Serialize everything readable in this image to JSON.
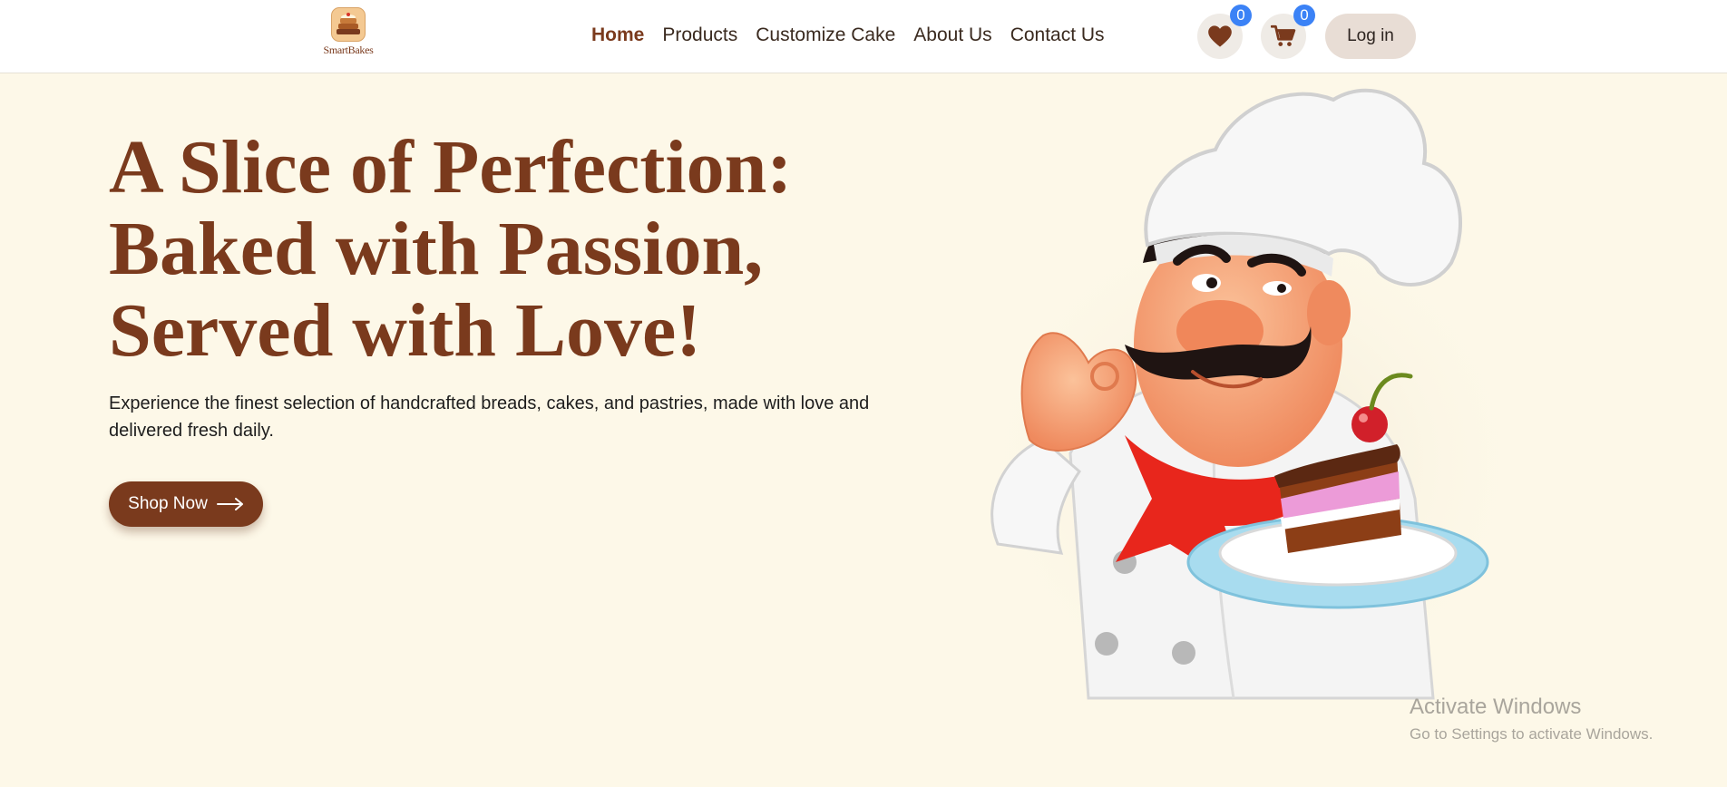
{
  "header": {
    "logo_text": "SmartBakes",
    "nav": [
      {
        "label": "Home",
        "active": true
      },
      {
        "label": "Products",
        "active": false
      },
      {
        "label": "Customize Cake",
        "active": false
      },
      {
        "label": "About Us",
        "active": false
      },
      {
        "label": "Contact Us",
        "active": false
      }
    ],
    "wishlist": {
      "icon": "heart-icon",
      "count": "0"
    },
    "cart": {
      "icon": "cart-icon",
      "count": "0"
    },
    "login_label": "Log in"
  },
  "hero": {
    "title_lines": [
      "A Slice of Perfection:",
      "Baked with Passion,",
      "Served with Love!"
    ],
    "description": "Experience the finest selection of handcrafted breads, cakes, and pastries, made with love and delivered fresh daily.",
    "cta_label": "Shop Now",
    "cta_icon": "arrow-right-icon",
    "illustration": "chef-with-cake-illustration"
  },
  "watermark": {
    "title": "Activate Windows",
    "subtitle": "Go to Settings to activate Windows."
  },
  "colors": {
    "brand_brown": "#7a3a1d",
    "hero_background": "#fdf8e8",
    "badge_blue": "#3b82f6",
    "login_background": "#e8ddd5"
  }
}
